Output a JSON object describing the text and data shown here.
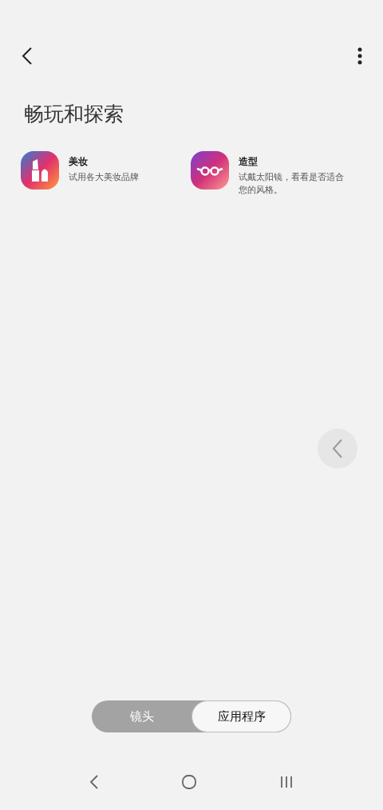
{
  "title": "畅玩和探索",
  "features": [
    {
      "name": "美妆",
      "description": "试用各大美妆品牌",
      "kind": "makeup"
    },
    {
      "name": "造型",
      "description": "试戴太阳镜，看看是否适合您的风格。",
      "kind": "glasses"
    }
  ],
  "tabs": [
    {
      "label": "镜头",
      "selected": false
    },
    {
      "label": "应用程序",
      "selected": true
    }
  ]
}
